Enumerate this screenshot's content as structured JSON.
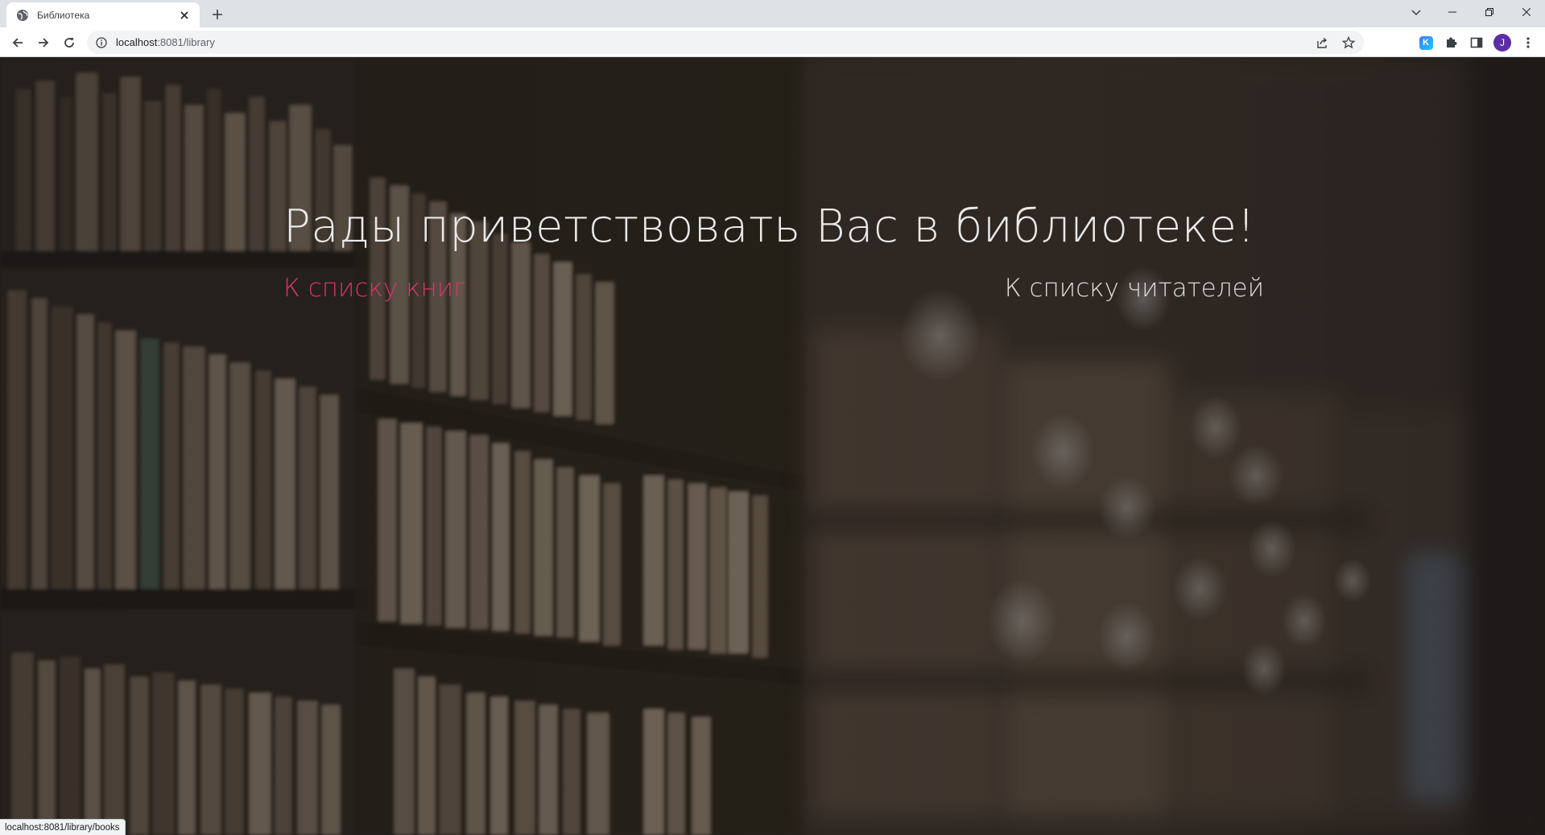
{
  "browser": {
    "tab_title": "Библиотека",
    "url_host": "localhost",
    "url_rest": ":8081/library",
    "profile_initial": "J",
    "extension_letter": "K",
    "status_url": "localhost:8081/library/books"
  },
  "page": {
    "welcome_text": "Рады приветствовать Вас в библиотеке!",
    "books_link": "К списку книг",
    "readers_link": "К списку читателей",
    "books_link_color": "#d6336c",
    "readers_link_color": "#dcdcdc"
  },
  "icons": {
    "tab": [
      "globe-icon",
      "close-icon",
      "plus-icon"
    ],
    "window": [
      "chevron-down-icon",
      "minimize-icon",
      "restore-icon",
      "close-window-icon"
    ],
    "toolbar": [
      "back-arrow-icon",
      "forward-arrow-icon",
      "reload-icon",
      "info-icon",
      "share-icon",
      "star-icon",
      "puzzle-icon",
      "side-panel-icon"
    ]
  }
}
